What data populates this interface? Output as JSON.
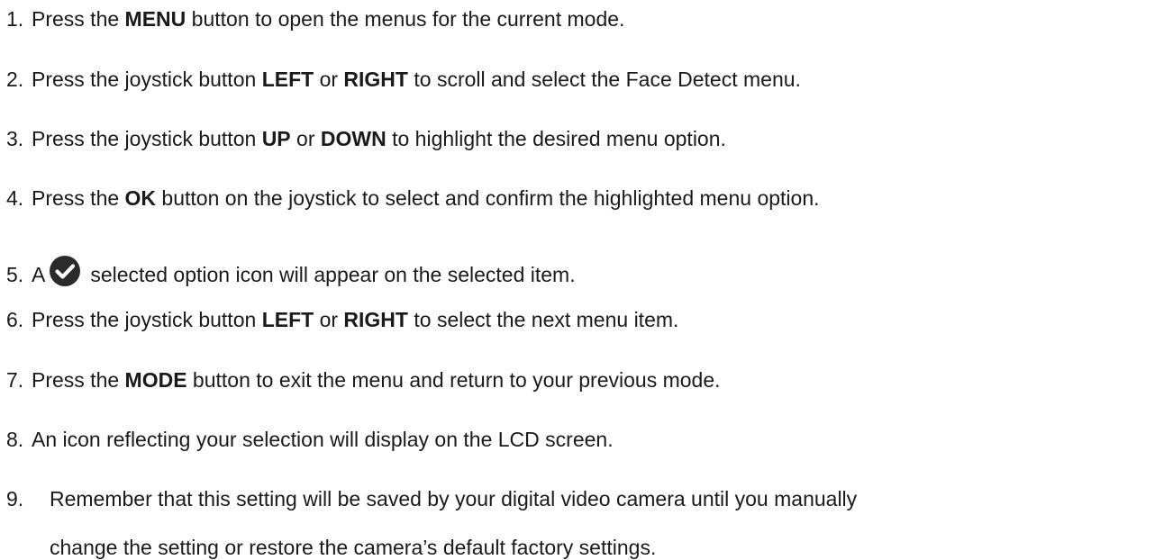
{
  "steps": [
    {
      "num": "1.",
      "pre": "Press the ",
      "bold": "MENU",
      "post": " button to open the menus for the current mode."
    },
    {
      "num": "2.",
      "pre": "Press the joystick button ",
      "bold1": "LEFT",
      "mid": " or ",
      "bold2": "RIGHT",
      "post": " to scroll and select the Face Detect menu."
    },
    {
      "num": "3.",
      "pre": "Press the joystick button ",
      "bold1": "UP",
      "mid": " or ",
      "bold2": "DOWN",
      "post": " to highlight the desired menu option."
    },
    {
      "num": "4.",
      "pre": "Press the ",
      "bold": "OK",
      "post": " button on the joystick to select and confirm the highlighted menu option."
    },
    {
      "num": "5.",
      "pre": "A",
      "icon": "check-circle-icon",
      "post": "selected option icon will appear on the selected item."
    },
    {
      "num": "6.",
      "pre": "Press the joystick button ",
      "bold1": "LEFT",
      "mid": " or ",
      "bold2": "RIGHT",
      "post": " to select the next menu item."
    },
    {
      "num": "7.",
      "pre": "Press the ",
      "bold": "MODE",
      "post": " button to exit the menu and return to your previous mode."
    },
    {
      "num": "8.",
      "text": "An icon reflecting your selection will display on the LCD screen."
    },
    {
      "num": "9.",
      "line1": "Remember that this setting will be saved by your digital video camera until you manually",
      "line2": "change the setting or restore the camera’s default factory settings."
    }
  ]
}
